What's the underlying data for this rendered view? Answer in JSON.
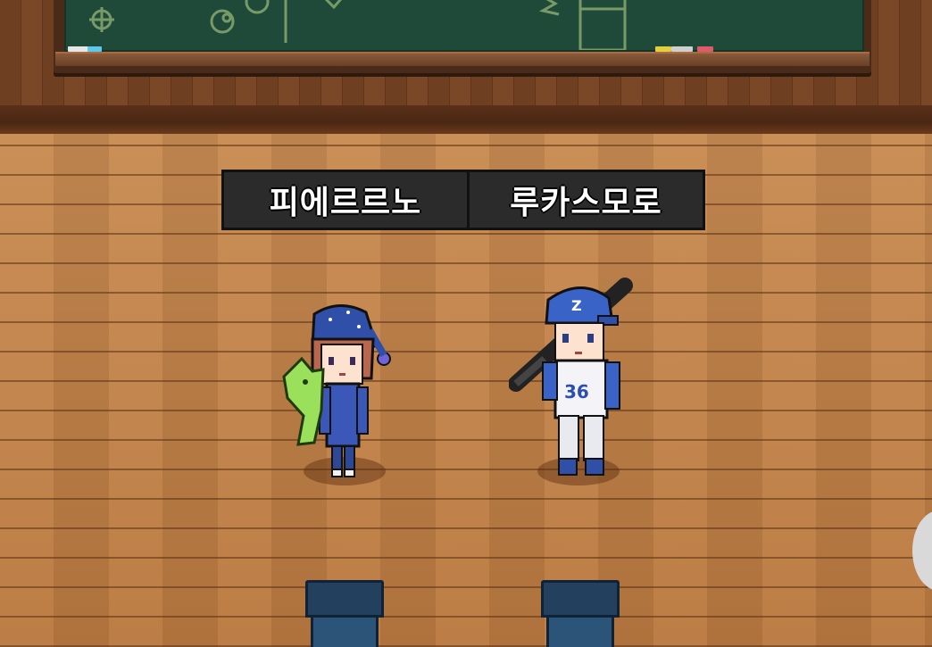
{
  "players": [
    {
      "name": "피에르르노"
    },
    {
      "name": "루카스모로"
    }
  ],
  "jersey_number": "36",
  "cap_letter": "Z",
  "colors": {
    "plate_bg": "#2b2b2b",
    "floor": "#c1834b",
    "board": "#1f4a3a",
    "chair": "#23405e"
  },
  "icons": [
    "side-menu-button"
  ]
}
